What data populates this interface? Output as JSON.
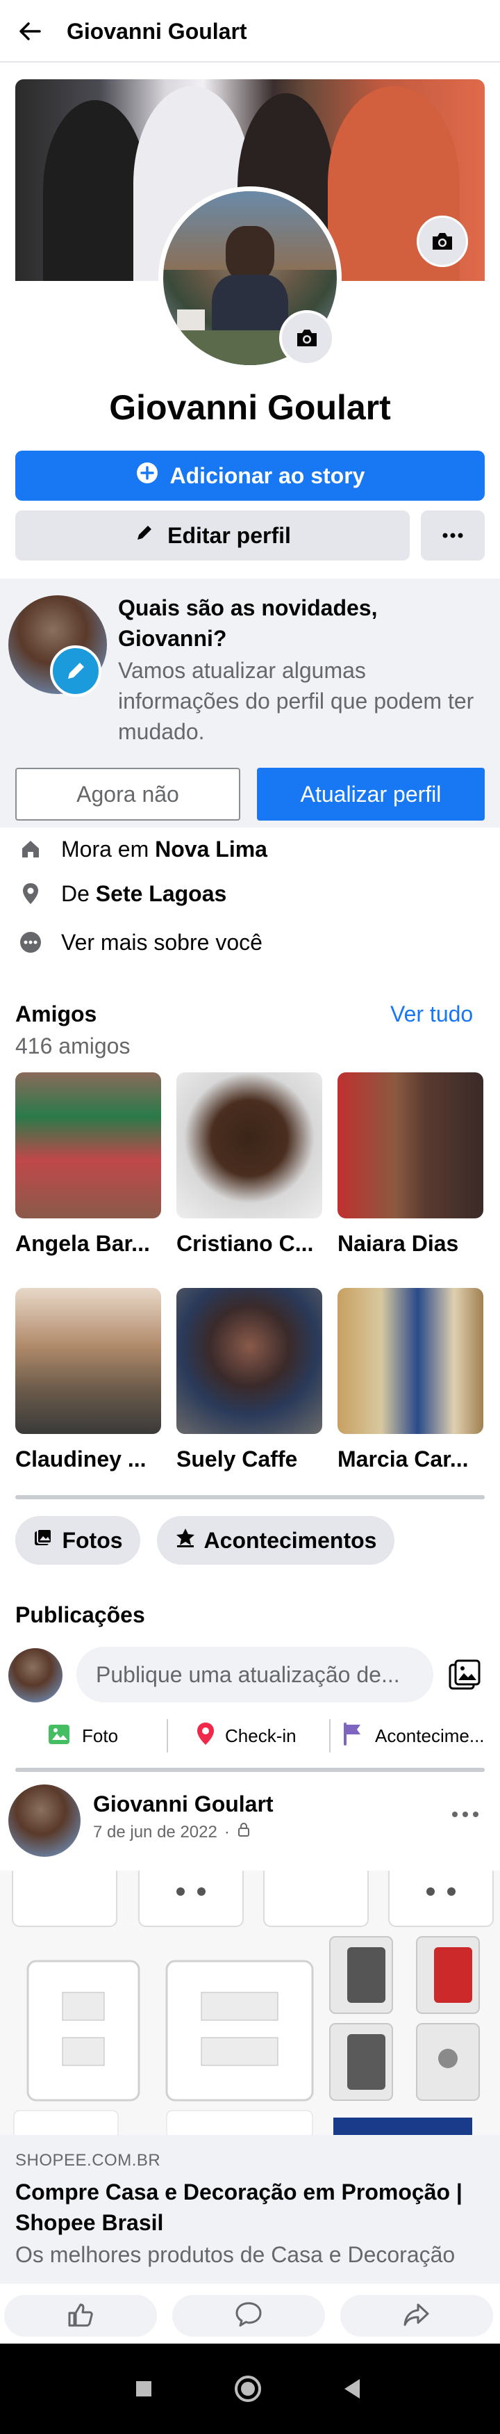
{
  "header": {
    "title": "Giovanni Goulart",
    "back_icon": "arrow-left-icon"
  },
  "profile": {
    "name": "Giovanni Goulart",
    "add_story_label": "Adicionar ao story",
    "edit_profile_label": "Editar perfil",
    "more_label": "…"
  },
  "prompt": {
    "title": "Quais são as novidades, Giovanni?",
    "text": "Vamos atualizar algumas informações do perfil que podem ter mudado.",
    "not_now_label": "Agora não",
    "update_label": "Atualizar perfil"
  },
  "details": {
    "lives_prefix": "Mora em",
    "lives_city": "Nova Lima",
    "from_prefix": "De",
    "from_city": "Sete Lagoas",
    "see_more": "Ver mais sobre você"
  },
  "friends": {
    "title": "Amigos",
    "count": "416 amigos",
    "see_all": "Ver tudo",
    "items": [
      {
        "name": "Angela Bar..."
      },
      {
        "name": "Cristiano C..."
      },
      {
        "name": "Naiara Dias"
      },
      {
        "name": "Claudiney ..."
      },
      {
        "name": "Suely Caffe"
      },
      {
        "name": "Marcia Car..."
      }
    ]
  },
  "chips": {
    "photos": "Fotos",
    "events": "Acontecimentos"
  },
  "posts": {
    "title": "Publicações",
    "composer_placeholder": "Publique uma atualização de...",
    "actions": {
      "photo": "Foto",
      "checkin": "Check-in",
      "event": "Acontecime..."
    }
  },
  "post": {
    "author": "Giovanni Goulart",
    "date": "7 de jun de 2022",
    "separator": "·",
    "link_domain": "SHOPEE.COM.BR",
    "link_title": "Compre Casa e Decoração em Promoção | Shopee Brasil",
    "link_desc": "Os melhores produtos de Casa e Decoração"
  },
  "colors": {
    "primary": "#1877f2",
    "button_gray": "#e4e6eb",
    "text_secondary": "#65676b",
    "background_gray": "#f0f2f5"
  }
}
